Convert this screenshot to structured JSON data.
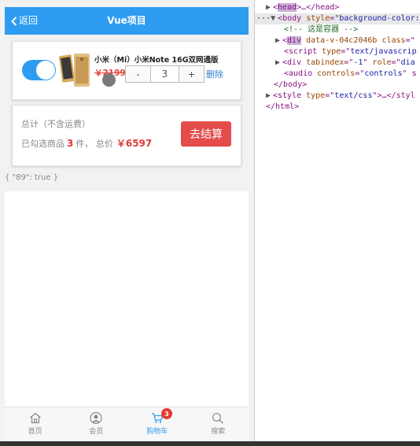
{
  "header": {
    "back_label": "返回",
    "title": "Vue项目"
  },
  "cart_item": {
    "selected": true,
    "name": "小米（Mi）小米Note 16G双网通版",
    "price": "￥2199",
    "qty_minus": "-",
    "quantity": "3",
    "qty_plus": "+",
    "delete_label": "删除"
  },
  "summary": {
    "total_label": "总计（不含运费）",
    "selected_prefix": "已勾选商品",
    "selected_count": "3",
    "selected_unit": "件，",
    "total_prefix": "总价",
    "total_amount": "￥6597",
    "checkout_label": "去结算"
  },
  "debug_text": "{ \"89\": true }",
  "tabbar": {
    "items": [
      {
        "label": "首页",
        "icon": "home-icon",
        "active": false
      },
      {
        "label": "会员",
        "icon": "member-icon",
        "active": false
      },
      {
        "label": "购物车",
        "icon": "cart-icon",
        "active": true,
        "badge": "3"
      },
      {
        "label": "搜索",
        "icon": "search-icon",
        "active": false
      }
    ]
  },
  "devtools": {
    "lines": [
      {
        "parts": [
          "<",
          "head",
          ">…</head>"
        ]
      },
      {
        "parts": [
          "<body ",
          "style",
          "=\"",
          "background-color:"
        ]
      },
      {
        "parts": [
          "<!-- 这是容器 -->"
        ]
      },
      {
        "parts": [
          "<",
          "div",
          " ",
          "data-v-04c2046b",
          " ",
          "class",
          "=\""
        ]
      },
      {
        "parts": [
          "<script ",
          "type",
          "=\"",
          "text/javascrip"
        ]
      },
      {
        "parts": [
          "<div ",
          "tabindex",
          "=\"",
          "-1",
          "\" ",
          "role",
          "=\"",
          "dia"
        ]
      },
      {
        "parts": [
          "<audio ",
          "controls",
          "=\"",
          "controls",
          "\" s"
        ]
      },
      {
        "parts": [
          "</body>"
        ]
      },
      {
        "parts": [
          "<style ",
          "type",
          "=\"",
          "text/css",
          "\">…</styl"
        ]
      },
      {
        "parts": [
          "</html>"
        ]
      }
    ]
  },
  "colors": {
    "primary": "#2e9cf0",
    "price_red": "#e23a3a",
    "checkout_red": "#e54c4c",
    "badge_red": "#e53935"
  }
}
